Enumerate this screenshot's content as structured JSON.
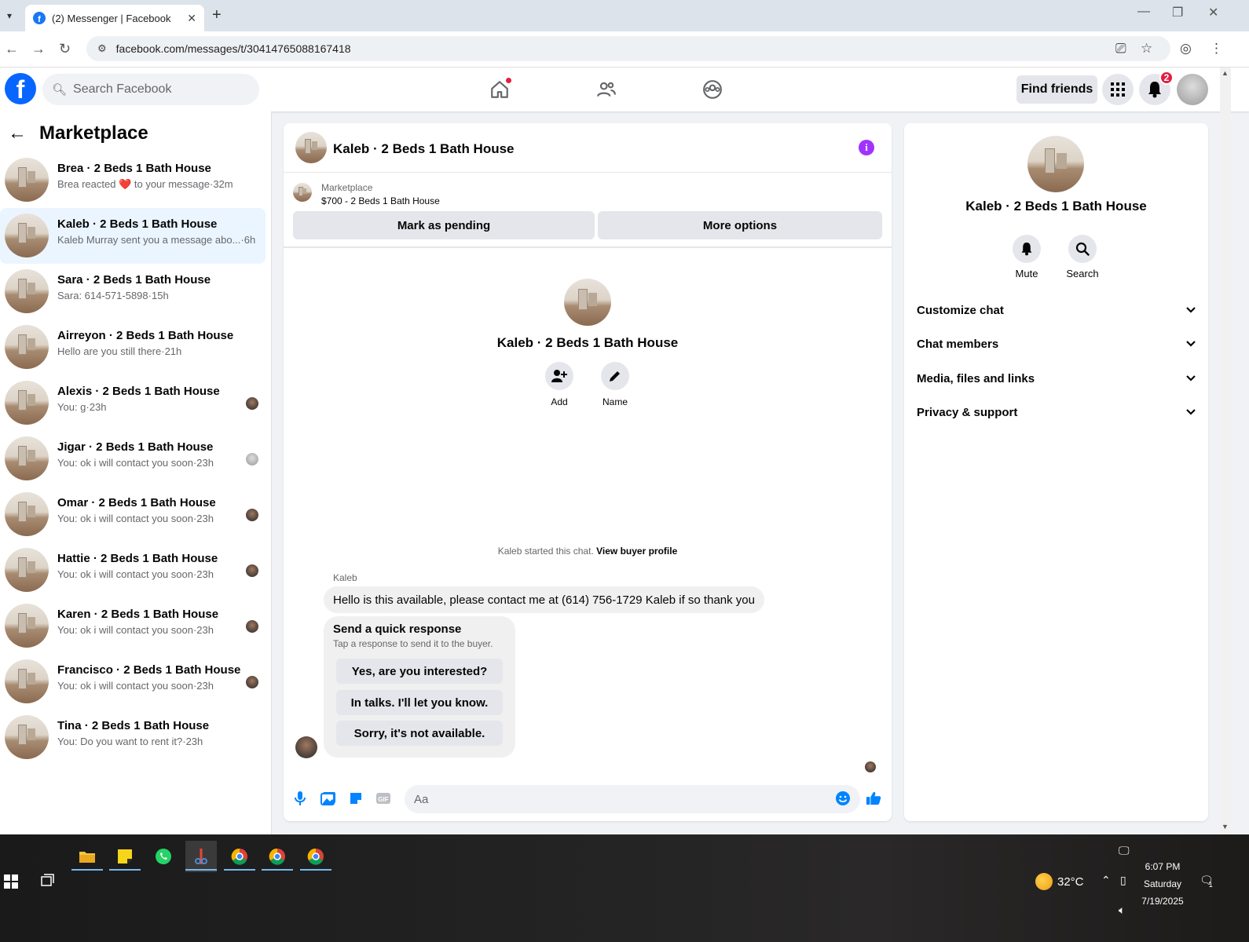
{
  "browser": {
    "tab_title": "(2) Messenger | Facebook",
    "url": "facebook.com/messages/t/30414765088167418"
  },
  "header": {
    "search_placeholder": "Search Facebook",
    "find_friends": "Find friends",
    "notifications_count": "2",
    "brand_color": "#0866ff"
  },
  "sidebar": {
    "title": "Marketplace",
    "conversations": [
      {
        "name": "Brea · 2 Beds 1 Bath House",
        "snippet_a": "Brea reacted",
        "snippet_icon": "❤️",
        "snippet_b": "to your message",
        "time": "·32m"
      },
      {
        "name": "Kaleb · 2 Beds 1 Bath House",
        "snippet": "Kaleb Murray sent you a message abo...",
        "time": "·6h",
        "active": true
      },
      {
        "name": "Sara · 2 Beds 1 Bath House",
        "snippet": "Sara: 614-571-5898",
        "time": "·15h"
      },
      {
        "name": "Airreyon · 2 Beds 1 Bath House",
        "snippet": "Hello are you still there",
        "time": "·21h"
      },
      {
        "name": "Alexis · 2 Beds 1 Bath House",
        "snippet": "You: g",
        "time": "·23h"
      },
      {
        "name": "Jigar · 2 Beds 1 Bath House",
        "snippet": "You: ok i will contact you soon",
        "time": "·23h"
      },
      {
        "name": "Omar · 2 Beds 1 Bath House",
        "snippet": "You: ok i will contact you soon",
        "time": "·23h"
      },
      {
        "name": "Hattie · 2 Beds 1 Bath House",
        "snippet": "You: ok i will contact you soon",
        "time": "·23h"
      },
      {
        "name": "Karen · 2 Beds 1 Bath House",
        "snippet": "You: ok i will contact you soon",
        "time": "·23h"
      },
      {
        "name": "Francisco · 2 Beds 1 Bath House",
        "snippet": "You: ok i will contact you soon",
        "time": "·23h"
      },
      {
        "name": "Tina · 2 Beds 1 Bath House",
        "snippet": "You: Do you want to rent it?",
        "time": "·23h"
      }
    ]
  },
  "chat": {
    "title": "Kaleb · 2 Beds 1 Bath House",
    "listing_source": "Marketplace",
    "listing_price": "$700 - 2 Beds 1 Bath House",
    "mark_pending": "Mark as pending",
    "more_options": "More options",
    "intro_name": "Kaleb · 2 Beds 1 Bath House",
    "add_label": "Add",
    "name_label": "Name",
    "started_text": "Kaleb started this chat.",
    "view_profile": "View buyer profile",
    "sender": "Kaleb",
    "message": "Hello is this available, please contact me at (614) 756-1729 Kaleb if so thank you",
    "quick_title": "Send a quick response",
    "quick_subtitle": "Tap a response to send it to the buyer.",
    "quick_responses": [
      "Yes, are you interested?",
      "In talks. I'll let you know.",
      "Sorry, it's not available."
    ],
    "composer_placeholder": "Aa",
    "accent_color": "#0084ff"
  },
  "details": {
    "name": "Kaleb · 2 Beds 1 Bath House",
    "mute": "Mute",
    "search": "Search",
    "sections": [
      "Customize chat",
      "Chat members",
      "Media, files and links",
      "Privacy & support"
    ]
  },
  "taskbar": {
    "temperature": "32°C",
    "time": "6:07 PM",
    "day": "Saturday",
    "date": "7/19/2025",
    "notification_count": "1"
  }
}
